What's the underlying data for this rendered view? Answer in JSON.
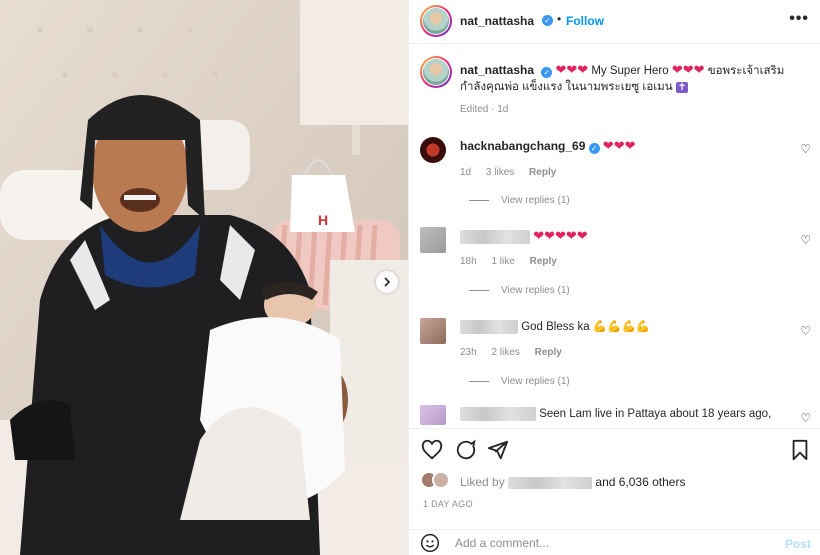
{
  "header": {
    "username": "nat_nattasha",
    "verified_icon": "verified-badge-icon",
    "separator": "•",
    "follow_label": "Follow",
    "more_label": "•••"
  },
  "caption": {
    "username": "nat_nattasha",
    "text_pre": "My Super Hero",
    "text_thai": "ขอพระเจ้าเสริมกำลังคุณพ่อ แข็งแรง ในนามพระเยซู เอเมน",
    "hearts": "❤❤❤",
    "cross": "✝",
    "meta": "Edited · 1d"
  },
  "comments": [
    {
      "username": "hacknabangchang_69",
      "text": "❤❤❤",
      "time": "1d",
      "likes": "3 likes",
      "reply": "Reply",
      "view_replies": "View replies (1)"
    },
    {
      "username": "",
      "text": "❤❤❤❤❤",
      "time": "18h",
      "likes": "1 like",
      "reply": "Reply",
      "view_replies": "View replies (1)"
    },
    {
      "username": "",
      "text": "God Bless ka",
      "emoji": "💪💪💪💪",
      "time": "23h",
      "likes": "2 likes",
      "reply": "Reply",
      "view_replies": "View replies (1)"
    },
    {
      "username": "",
      "text": "Seen Lam live in Pattaya about 18 years ago,"
    }
  ],
  "actions": {
    "likes_prefix": "Liked by",
    "likes_suffix": "and 6,036 others",
    "posted": "1 DAY AGO"
  },
  "add_comment": {
    "placeholder": "Add a comment...",
    "post_label": "Post"
  },
  "colors": {
    "accent": "#0095f6",
    "heart": "#e0245e",
    "muted": "#8e8e8e"
  }
}
